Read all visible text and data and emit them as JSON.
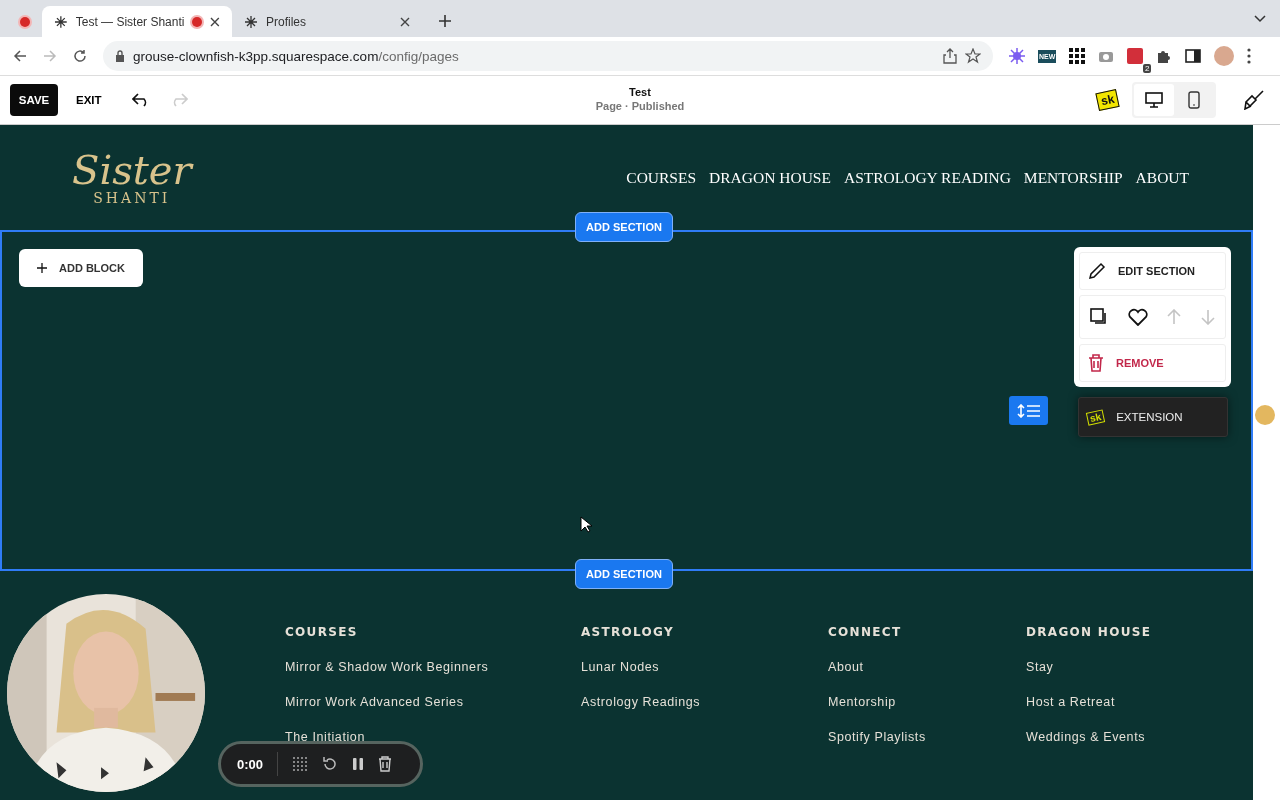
{
  "browser": {
    "tabs": [
      {
        "kind": "pinned",
        "selected": false,
        "recording": true
      },
      {
        "kind": "page",
        "title": "Test — Sister Shanti",
        "selected": true,
        "recording": true
      },
      {
        "kind": "page",
        "title": "Profiles",
        "selected": false,
        "recording": false
      }
    ],
    "url": {
      "host": "grouse-clownfish-k3pp.squarespace.com",
      "path": "/config/pages"
    },
    "extension_new_label": "NEW",
    "extension_badge": "2"
  },
  "editor": {
    "save": "SAVE",
    "exit": "EXIT",
    "page_title": "Test",
    "page_status": "Page · Published",
    "sk_label": "sk",
    "devices": [
      {
        "kind": "desktop",
        "selected": true
      },
      {
        "kind": "mobile",
        "selected": false
      }
    ]
  },
  "site": {
    "logo": {
      "script": "Sister",
      "sub": "SHANTI"
    },
    "nav": [
      "COURSES",
      "DRAGON HOUSE",
      "ASTROLOGY READING",
      "MENTORSHIP",
      "ABOUT"
    ],
    "add_section_top": "ADD SECTION",
    "add_section_bottom": "ADD SECTION",
    "add_block": "ADD BLOCK",
    "section_menu": {
      "edit": "EDIT SECTION",
      "actions": [
        {
          "kind": "duplicate",
          "disabled": false
        },
        {
          "kind": "favorite",
          "disabled": false
        },
        {
          "kind": "up",
          "disabled": true
        },
        {
          "kind": "down",
          "disabled": true
        }
      ],
      "remove": "REMOVE",
      "extension": "EXTENSION",
      "extension_logo": "sk"
    },
    "footer": [
      {
        "heading": "COURSES",
        "links": [
          "Mirror & Shadow Work Beginners",
          "Mirror Work Advanced Series",
          "The Initiation"
        ]
      },
      {
        "heading": "ASTROLOGY",
        "links": [
          "Lunar Nodes",
          "Astrology Readings"
        ]
      },
      {
        "heading": "CONNECT",
        "links": [
          "About",
          "Mentorship",
          "Spotify Playlists"
        ]
      },
      {
        "heading": "DRAGON HOUSE",
        "links": [
          "Stay",
          "Host a Retreat",
          "Weddings & Events"
        ]
      }
    ]
  },
  "recorder": {
    "time": "0:00"
  }
}
